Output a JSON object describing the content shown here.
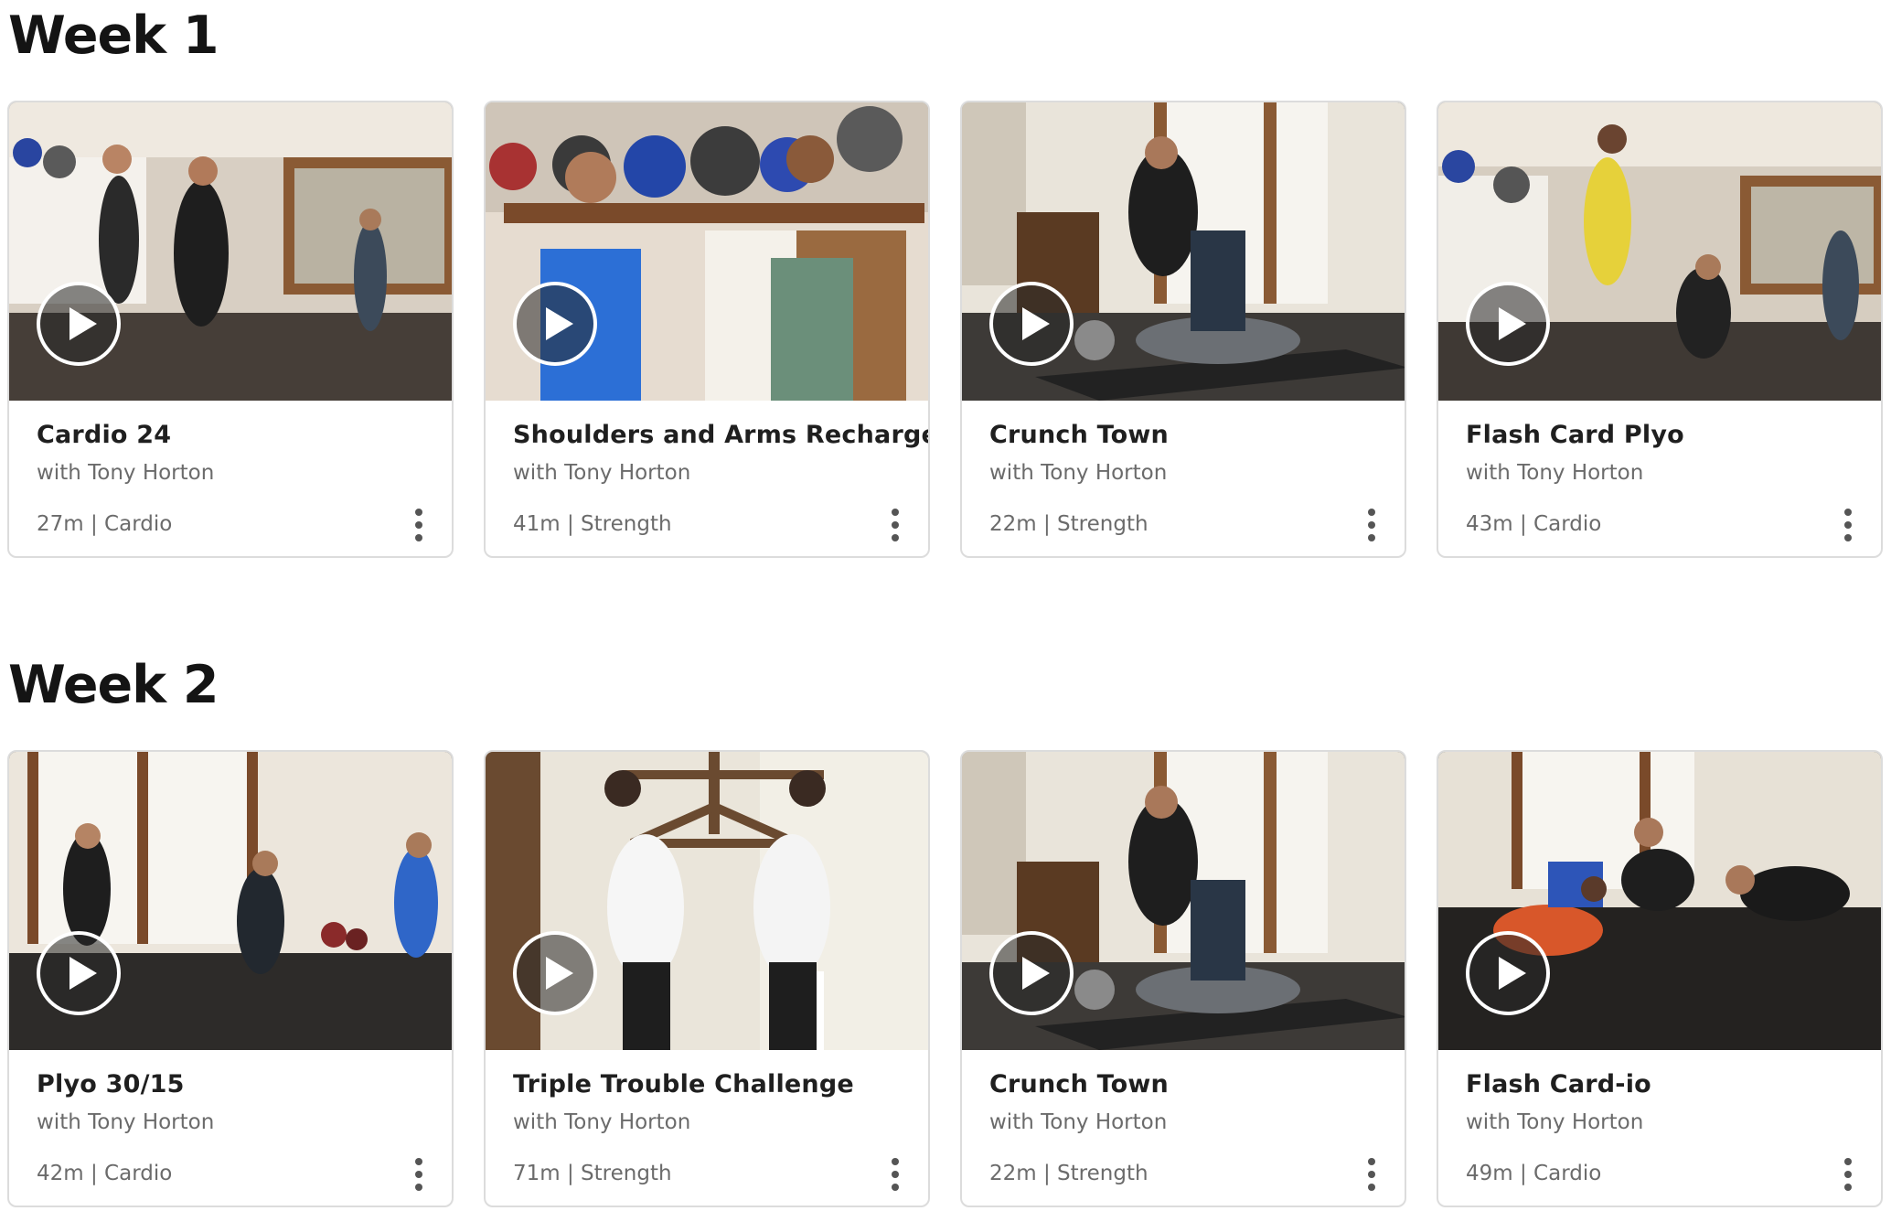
{
  "weeks": [
    {
      "title": "Week 1",
      "workouts": [
        {
          "title": "Cardio 24",
          "instructor": "with Tony Horton",
          "meta": "27m | Cardio"
        },
        {
          "title": "Shoulders and Arms Recharge",
          "instructor": "with Tony Horton",
          "meta": "41m | Strength"
        },
        {
          "title": "Crunch Town",
          "instructor": "with Tony Horton",
          "meta": "22m | Strength"
        },
        {
          "title": "Flash Card Plyo",
          "instructor": "with Tony Horton",
          "meta": "43m | Cardio"
        }
      ]
    },
    {
      "title": "Week 2",
      "workouts": [
        {
          "title": "Plyo 30/15",
          "instructor": "with Tony Horton",
          "meta": "42m | Cardio"
        },
        {
          "title": "Triple Trouble Challenge",
          "instructor": "with Tony Horton",
          "meta": "71m | Strength"
        },
        {
          "title": "Crunch Town",
          "instructor": "with Tony Horton",
          "meta": "22m | Strength"
        },
        {
          "title": "Flash Card-io",
          "instructor": "with Tony Horton",
          "meta": "49m | Cardio"
        }
      ]
    }
  ],
  "icons": {
    "play": "play-icon",
    "more": "more-vertical-icon"
  },
  "colors": {
    "card_border": "#dcdcdc",
    "title_text": "#1f1f1f",
    "secondary_text": "#6b6b6b"
  }
}
